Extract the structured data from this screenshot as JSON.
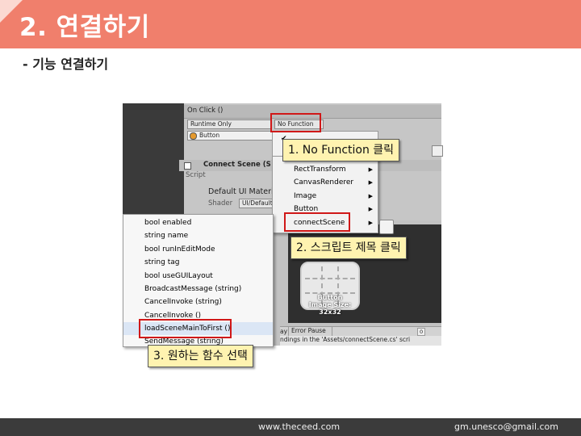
{
  "slide": {
    "title": "2. 연결하기",
    "subtitle": "- 기능 연결하기"
  },
  "footer": {
    "website": "www.theceed.com",
    "email": "gm.unesco@gmail.com"
  },
  "inspector": {
    "onclick_label": "On Click ()",
    "runtime_dropdown": "Runtime Only",
    "function_dropdown": "No Function",
    "target_field": "Button",
    "script_component": "Connect Scene (S",
    "script_label": "Script",
    "material_label": "Default UI Materi",
    "shader_label": "Shader",
    "shader_value": "UI/Default"
  },
  "component_menu": {
    "items": [
      {
        "label": "RectTransform"
      },
      {
        "label": "CanvasRenderer"
      },
      {
        "label": "Image"
      },
      {
        "label": "Button"
      },
      {
        "label": "connectScene"
      }
    ]
  },
  "function_menu": {
    "items": [
      {
        "label": "bool enabled"
      },
      {
        "label": "string name"
      },
      {
        "label": "bool runInEditMode"
      },
      {
        "label": "string tag"
      },
      {
        "label": "bool useGUILayout"
      },
      {
        "label": "BroadcastMessage (string)"
      },
      {
        "label": "CancelInvoke (string)"
      },
      {
        "label": "CancelInvoke ()"
      },
      {
        "label": "loadSceneMainToFirst ()"
      },
      {
        "label": "SendMessage (string)"
      }
    ]
  },
  "preview": {
    "label": "Button",
    "size": "Image Size: 32x32"
  },
  "console": {
    "pause_tab": "ay",
    "error_pause": "Error Pause",
    "count": "0",
    "message": "ndings in the 'Assets/connectScene.cs' scri"
  },
  "callouts": {
    "step1": "1. No Function 클릭",
    "step2": "2. 스크립트 제목 클릭",
    "step3": "3. 원하는 함수 선택"
  },
  "colors": {
    "header": "#f07f6c",
    "highlight": "#d01818",
    "callout_bg": "#fff3b0",
    "footer": "#3b3b3b"
  }
}
